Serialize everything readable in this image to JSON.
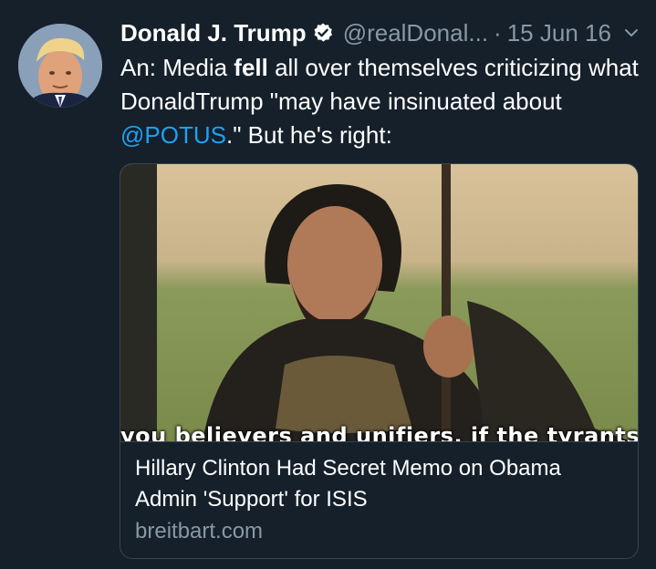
{
  "tweet": {
    "author_name": "Donald J. Trump",
    "handle": "@realDonal...",
    "separator": "·",
    "date": "15 Jun 16",
    "text_prefix": "An: Media ",
    "text_bold": "fell",
    "text_middle": " all over themselves criticizing what DonaldTrump \"may have insinuated about ",
    "mention": "@POTUS",
    "text_suffix": ".\" But he's right:",
    "verified_icon": "verified-badge-icon",
    "menu_icon": "chevron-down-icon"
  },
  "card": {
    "image_caption": "you believers and unifiers, if the tyrants hav",
    "title": "Hillary Clinton Had Secret Memo on Obama Admin 'Support' for ISIS",
    "domain": "breitbart.com"
  },
  "colors": {
    "background": "#15202b",
    "secondary_text": "#8899a6",
    "link": "#1da1f2",
    "border": "#38444d"
  }
}
